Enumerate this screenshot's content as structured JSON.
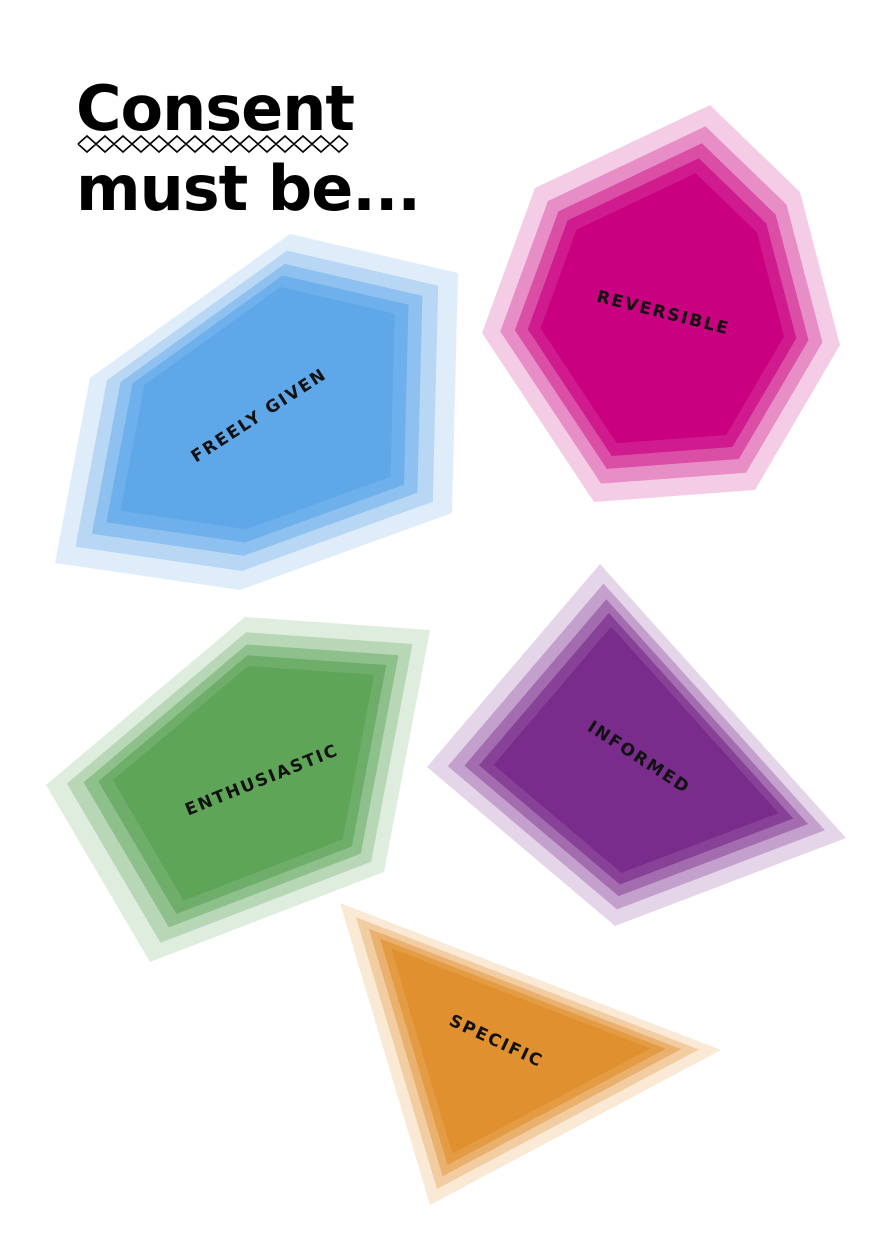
{
  "heading": {
    "line1": "Consent",
    "line2": "must be..."
  },
  "shapes": [
    {
      "label": "FREELY GIVEN",
      "color": "#5ea7e8"
    },
    {
      "label": "REVERSIBLE",
      "color": "#c9007f"
    },
    {
      "label": "ENTHUSIASTIC",
      "color": "#5ea558"
    },
    {
      "label": "INFORMED",
      "color": "#7a2c8c"
    },
    {
      "label": "SPECIFIC",
      "color": "#e0902e"
    }
  ]
}
